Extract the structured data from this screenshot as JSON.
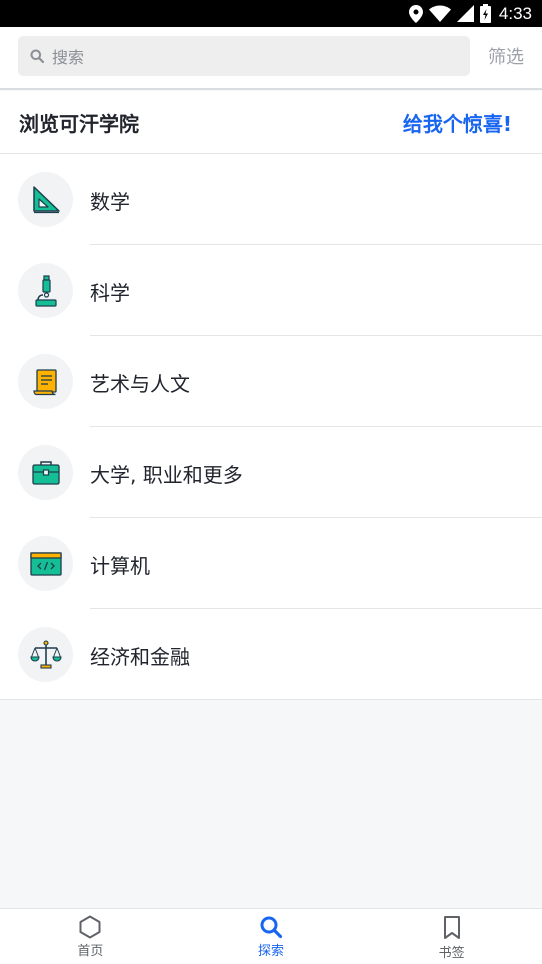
{
  "status_bar": {
    "time": "4:33"
  },
  "search": {
    "placeholder": "搜索",
    "filter_label": "筛选"
  },
  "browse": {
    "title": "浏览可汗学院",
    "surprise_label": "给我个惊喜!",
    "categories": [
      {
        "label": "数学",
        "icon": "triangle-ruler-icon"
      },
      {
        "label": "科学",
        "icon": "microscope-icon"
      },
      {
        "label": "艺术与人文",
        "icon": "scroll-icon"
      },
      {
        "label": "大学, 职业和更多",
        "icon": "briefcase-icon"
      },
      {
        "label": "计算机",
        "icon": "code-window-icon"
      },
      {
        "label": "经济和金融",
        "icon": "balance-scale-icon"
      }
    ]
  },
  "tabs": [
    {
      "label": "首页",
      "icon": "hexagon-icon",
      "active": false
    },
    {
      "label": "探索",
      "icon": "search-icon",
      "active": true
    },
    {
      "label": "书签",
      "icon": "bookmark-icon",
      "active": false
    }
  ],
  "colors": {
    "accent": "#1865f2",
    "icon_teal": "#14bf96",
    "icon_yellow": "#ffb100",
    "icon_dark": "#1e3d4d"
  }
}
